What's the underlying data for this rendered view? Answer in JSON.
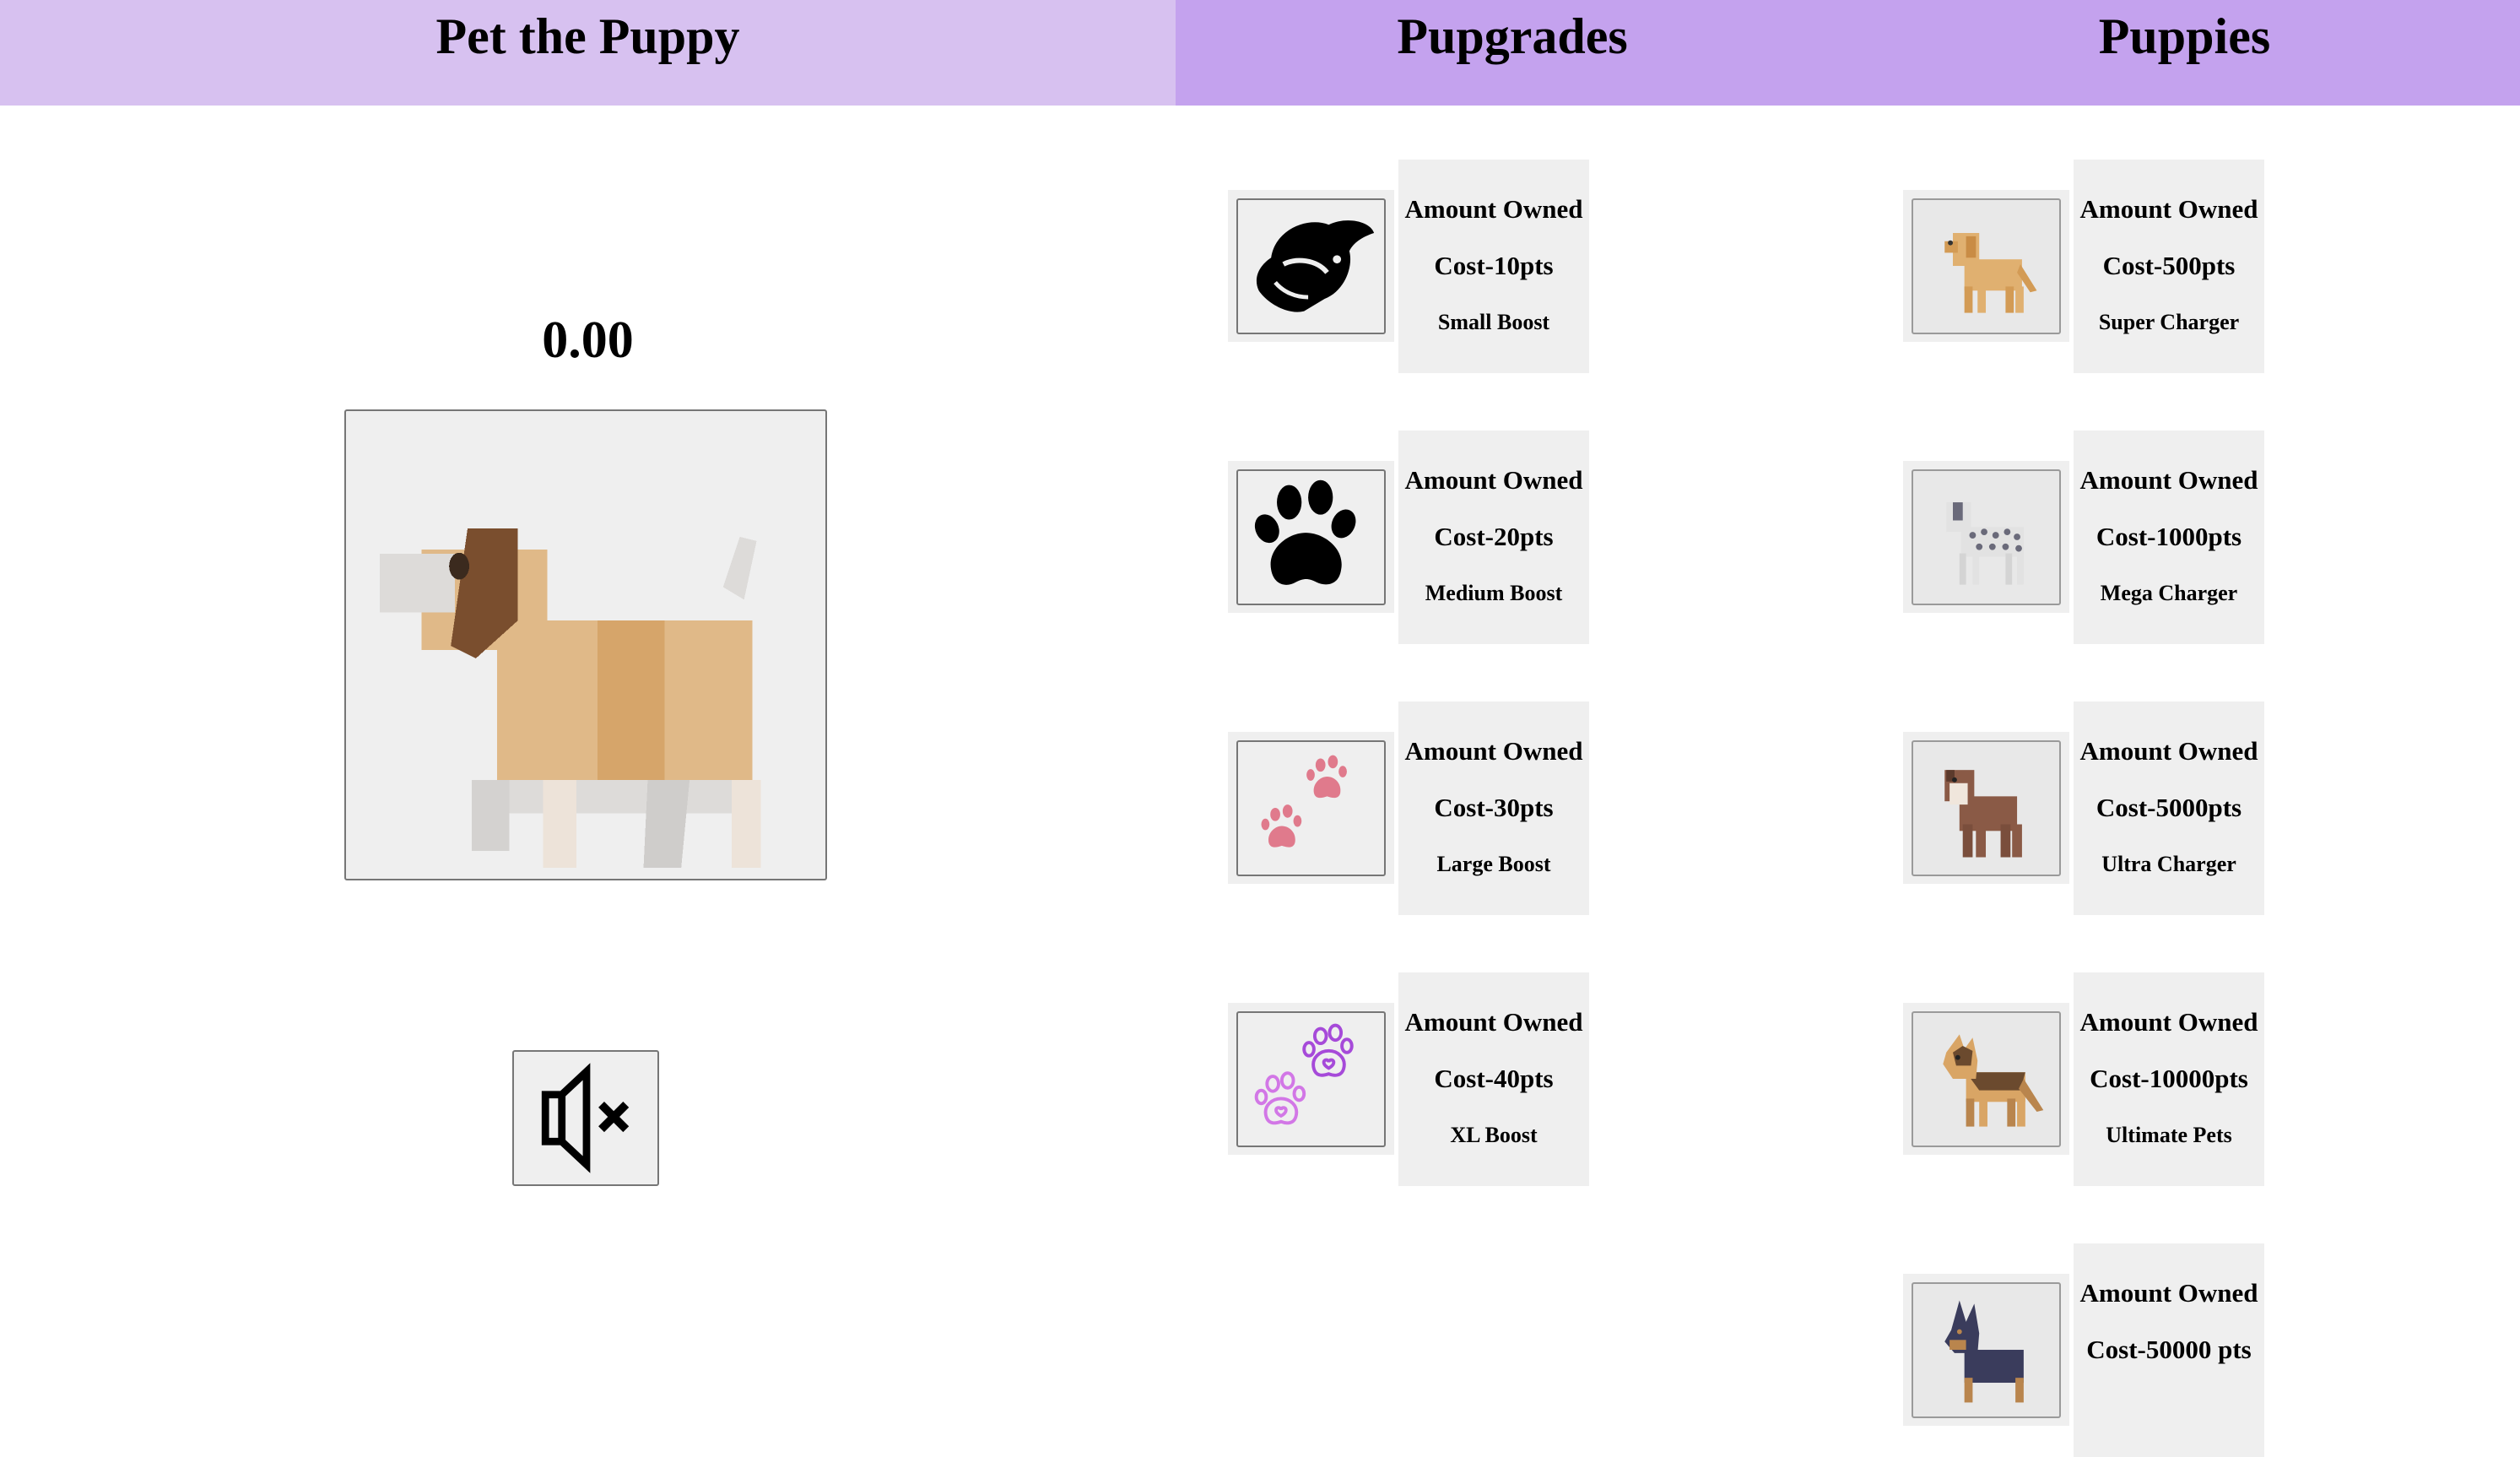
{
  "headers": {
    "pet": "Pet the Puppy",
    "pupgrades": "Pupgrades",
    "puppies": "Puppies"
  },
  "score": "0.00",
  "pupgrades": [
    {
      "owned": "Amount Owned",
      "cost": "Cost-10pts",
      "desc": "Small Boost",
      "icon": "dog-head-icon"
    },
    {
      "owned": "Amount Owned",
      "cost": "Cost-20pts",
      "desc": "Medium Boost",
      "icon": "paw-icon"
    },
    {
      "owned": "Amount Owned",
      "cost": "Cost-30pts",
      "desc": "Large Boost",
      "icon": "pink-paws-icon"
    },
    {
      "owned": "Amount Owned",
      "cost": "Cost-40pts",
      "desc": "XL Boost",
      "icon": "purple-heart-paws-icon"
    }
  ],
  "puppies": [
    {
      "owned": "Amount Owned",
      "cost": "Cost-500pts",
      "desc": "Super Charger",
      "icon": "golden-retriever-icon"
    },
    {
      "owned": "Amount Owned",
      "cost": "Cost-1000pts",
      "desc": "Mega Charger",
      "icon": "dalmatian-icon"
    },
    {
      "owned": "Amount Owned",
      "cost": "Cost-5000pts",
      "desc": "Ultra Charger",
      "icon": "pitbull-icon"
    },
    {
      "owned": "Amount Owned",
      "cost": "Cost-10000pts",
      "desc": "Ultimate Pets",
      "icon": "german-shepherd-icon"
    },
    {
      "owned": "Amount Owned",
      "cost": "Cost-50000 pts",
      "desc": "",
      "icon": "doberman-icon"
    }
  ],
  "colors": {
    "header_light": "#d7c1f0",
    "header_dark": "#c4a2ee",
    "panel": "#efefef"
  }
}
